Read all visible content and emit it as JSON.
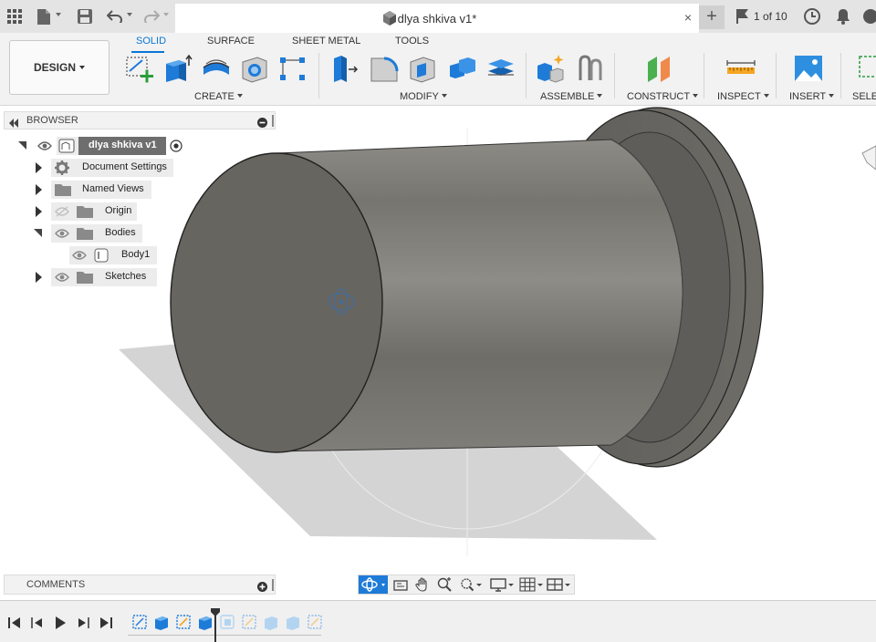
{
  "app_bar": {
    "tab_title": "dlya shkiva v1*",
    "tab_close": "×",
    "new_tab": "+",
    "version": "1 of 10"
  },
  "toolbar": {
    "workspace_button": "DESIGN",
    "tabs": [
      "SOLID",
      "SURFACE",
      "SHEET METAL",
      "TOOLS"
    ],
    "active_tab": "SOLID",
    "panels": [
      "CREATE",
      "MODIFY",
      "ASSEMBLE",
      "CONSTRUCT",
      "INSPECT",
      "INSERT",
      "SELE"
    ]
  },
  "browser": {
    "title": "BROWSER",
    "root": "dlya shkiva v1",
    "items": [
      {
        "label": "Document Settings",
        "icon": "gear-icon",
        "expanded": false
      },
      {
        "label": "Named Views",
        "icon": "folder-icon",
        "expanded": false
      },
      {
        "label": "Origin",
        "icon": "folder-icon",
        "expanded": false,
        "hidden": true
      },
      {
        "label": "Bodies",
        "icon": "folder-icon",
        "expanded": true
      },
      {
        "label": "Body1",
        "icon": "body-icon",
        "child": true
      },
      {
        "label": "Sketches",
        "icon": "folder-icon",
        "expanded": false
      }
    ]
  },
  "comments": {
    "title": "COMMENTS"
  },
  "colors": {
    "accent": "#0a76d6",
    "body_dark": "#63615d",
    "body_light": "#8a8984",
    "shadow": "#d3d3d3",
    "plus_green": "#2a9d3a"
  }
}
